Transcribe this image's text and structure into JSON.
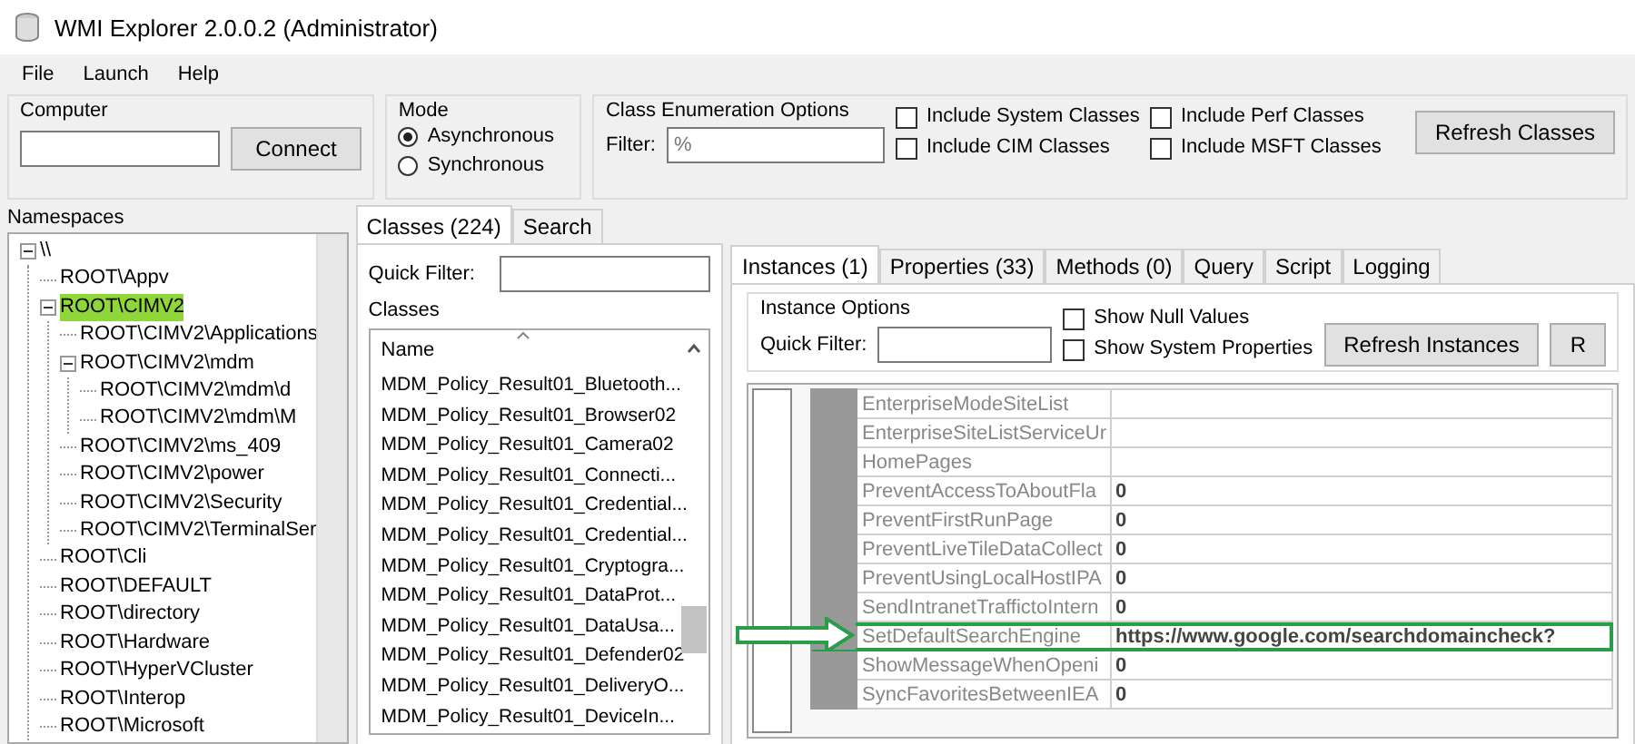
{
  "window": {
    "title": "WMI Explorer 2.0.0.2 (Administrator)"
  },
  "menu": [
    "File",
    "Launch",
    "Help"
  ],
  "computer": {
    "label": "Computer",
    "button": "Connect"
  },
  "mode": {
    "label": "Mode",
    "options": [
      {
        "label": "Asynchronous",
        "selected": true
      },
      {
        "label": "Synchronous",
        "selected": false
      }
    ]
  },
  "class_enumeration": {
    "label": "Class Enumeration Options",
    "filter_label": "Filter:",
    "filter_value": "%",
    "options": [
      {
        "label": "Include System Classes",
        "checked": false
      },
      {
        "label": "Include CIM Classes",
        "checked": false
      },
      {
        "label": "Include Perf Classes",
        "checked": false
      },
      {
        "label": "Include MSFT Classes",
        "checked": false
      }
    ],
    "button": "Refresh Classes"
  },
  "namespaces": {
    "label": "Namespaces",
    "tree": [
      {
        "label": "\\\\",
        "expanded": true,
        "selected": false,
        "children": [
          {
            "label": "ROOT\\Appv",
            "selected": false
          },
          {
            "label": "ROOT\\CIMV2",
            "expanded": true,
            "selected": true,
            "children": [
              {
                "label": "ROOT\\CIMV2\\Applications",
                "selected": false
              },
              {
                "label": "ROOT\\CIMV2\\mdm",
                "expanded": true,
                "selected": false,
                "children": [
                  {
                    "label": "ROOT\\CIMV2\\mdm\\d",
                    "selected": false
                  },
                  {
                    "label": "ROOT\\CIMV2\\mdm\\M",
                    "selected": false
                  }
                ]
              },
              {
                "label": "ROOT\\CIMV2\\ms_409",
                "selected": false
              },
              {
                "label": "ROOT\\CIMV2\\power",
                "selected": false
              },
              {
                "label": "ROOT\\CIMV2\\Security",
                "selected": false
              },
              {
                "label": "ROOT\\CIMV2\\TerminalSer",
                "selected": false
              }
            ]
          },
          {
            "label": "ROOT\\Cli",
            "selected": false
          },
          {
            "label": "ROOT\\DEFAULT",
            "selected": false
          },
          {
            "label": "ROOT\\directory",
            "selected": false
          },
          {
            "label": "ROOT\\Hardware",
            "selected": false
          },
          {
            "label": "ROOT\\HyperVCluster",
            "selected": false
          },
          {
            "label": "ROOT\\Interop",
            "selected": false
          },
          {
            "label": "ROOT\\Microsoft",
            "selected": false
          }
        ]
      }
    ]
  },
  "class_tabs": [
    {
      "label": "Classes (224)",
      "selected": true
    },
    {
      "label": "Search",
      "selected": false
    }
  ],
  "classes": {
    "quick_filter_label": "Quick Filter:",
    "group_label": "Classes",
    "column": "Name",
    "items": [
      "MDM_Policy_Result01_Bluetooth...",
      "MDM_Policy_Result01_Browser02",
      "MDM_Policy_Result01_Camera02",
      "MDM_Policy_Result01_Connecti...",
      "MDM_Policy_Result01_Credential...",
      "MDM_Policy_Result01_Credential...",
      "MDM_Policy_Result01_Cryptogra...",
      "MDM_Policy_Result01_DataProt...",
      "MDM_Policy_Result01_DataUsa...",
      "MDM_Policy_Result01_Defender02",
      "MDM_Policy_Result01_DeliveryO...",
      "MDM_Policy_Result01_DeviceIn..."
    ]
  },
  "instance_tabs": [
    {
      "label": "Instances (1)",
      "selected": true
    },
    {
      "label": "Properties (33)",
      "selected": false
    },
    {
      "label": "Methods (0)",
      "selected": false
    },
    {
      "label": "Query",
      "selected": false
    },
    {
      "label": "Script",
      "selected": false
    },
    {
      "label": "Logging",
      "selected": false
    }
  ],
  "instance_options": {
    "label": "Instance Options",
    "quick_filter_label": "Quick Filter:",
    "options": [
      {
        "label": "Show Null Values",
        "checked": false
      },
      {
        "label": "Show System Properties",
        "checked": false
      }
    ],
    "buttons": [
      "Refresh Instances",
      "R"
    ]
  },
  "properties": [
    {
      "name": "EnterpriseModeSiteList",
      "highlighted": false
    },
    {
      "name": "EnterpriseSiteListServiceUr",
      "highlighted": false
    },
    {
      "name": "HomePages",
      "highlighted": false
    },
    {
      "name": "PreventAccessToAboutFla",
      "value": "0",
      "highlighted": false
    },
    {
      "name": "PreventFirstRunPage",
      "value": "0",
      "highlighted": false
    },
    {
      "name": "PreventLiveTileDataCollect",
      "value": "0",
      "highlighted": false
    },
    {
      "name": "PreventUsingLocalHostIPA",
      "value": "0",
      "highlighted": false
    },
    {
      "name": "SendIntranetTraffictoIntern",
      "value": "0",
      "highlighted": false
    },
    {
      "name": "SetDefaultSearchEngine",
      "value": "https://www.google.com/searchdomaincheck?",
      "highlighted": true
    },
    {
      "name": "ShowMessageWhenOpeni",
      "value": "0",
      "highlighted": false
    },
    {
      "name": "SyncFavoritesBetweenIEA",
      "value": "0",
      "highlighted": false
    }
  ]
}
